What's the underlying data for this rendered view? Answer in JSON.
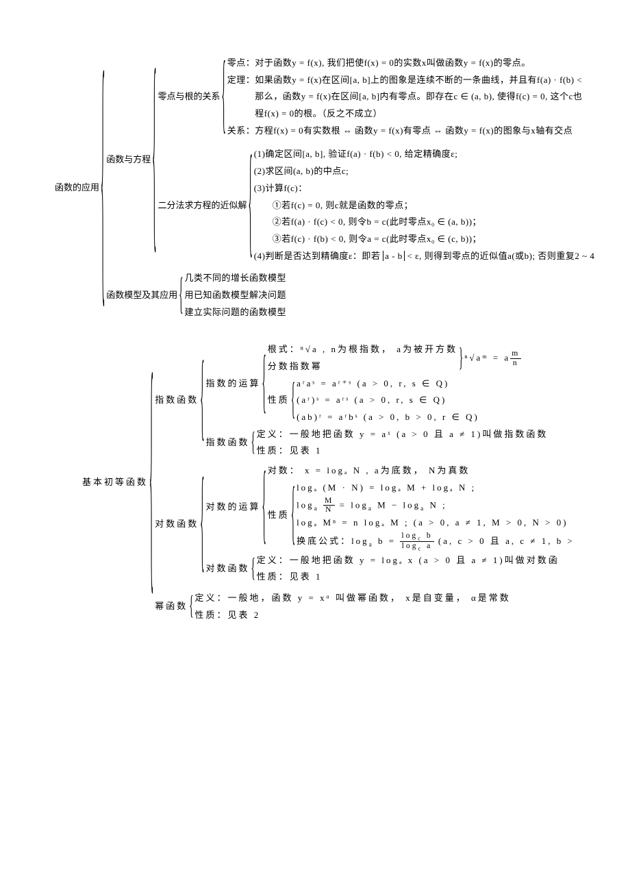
{
  "section1": {
    "root": "函数的应用",
    "b1": {
      "label": "函数与方程",
      "c1": {
        "label": "零点与根的关系",
        "lines": [
          "零点：对于函数y = f(x), 我们把使f(x) = 0的实数x叫做函数y = f(x)的零点。",
          "定理：如果函数y = f(x)在区间[a, b]上的图象是连续不断的一条曲线，并且有f(a) · f(b) < ",
          "　　　那么，函数y = f(x)在区间[a, b]内有零点。即存在c ∈ (a, b), 使得f(c) = 0, 这个c也",
          "　　　程f(x) = 0的根。（反之不成立）",
          "关系：方程f(x) = 0有实数根 ⇔ 函数y = f(x)有零点 ⇔ 函数y = f(x)的图象与x轴有交点"
        ]
      },
      "c2": {
        "label": "二分法求方程的近似解",
        "lines": [
          "(1)确定区间[a, b], 验证f(a) · f(b) < 0, 给定精确度ε;",
          "(2)求区间(a, b)的中点c;",
          "(3)计算f(c)：",
          "　　①若f(c) = 0, 则c就是函数的零点；",
          "　　②若f(a) · f(c) < 0, 则令b = c(此时零点x₀ ∈ (a, b))；",
          "　　③若f(c) · f(b) < 0, 则令a = c(此时零点x₀ ∈ (c, b))；",
          "(4)判断是否达到精确度ε：即若|a - b| < ε, 则得到零点的近似值a(或b); 否则重复2 ~ 4"
        ]
      }
    },
    "b2": {
      "label": "函数模型及其应用",
      "lines": [
        "几类不同的增长函数模型",
        "用已知函数模型解决问题",
        "建立实际问题的函数模型"
      ]
    }
  },
  "section2": {
    "root": "基本初等函数",
    "exp": {
      "label": "指数函数",
      "yunsuan": {
        "label": "指数的运算",
        "radical": "根式：ⁿ√a , n为根指数， a为被开方数",
        "fenzhishu": "分数指数幂",
        "radical_eq": "ⁿ√aᵐ = a",
        "radical_eq_frac_n": "m",
        "radical_eq_frac_d": "n",
        "xingzhi_label": "性质",
        "rules": [
          "aʳaˢ = aʳ⁺ˢ (a > 0, r, s ∈ Q)",
          "(aʳ)ˢ = aʳˢ (a > 0, r, s ∈ Q)",
          "(ab)ʳ = aʳbˢ (a > 0, b > 0, r ∈ Q)"
        ]
      },
      "hanshu": {
        "label": "指数函数",
        "def": "定义：一般地把函数 y = aˣ (a > 0 且 a ≠ 1)叫做指数函数",
        "prop": "性质：见表 1"
      }
    },
    "log": {
      "label": "对数函数",
      "yunsuan": {
        "label": "对数的运算",
        "duishu": "对数： x = logₐ N , a为底数， N为真数",
        "xingzhi_label": "性质",
        "rules": [
          "logₐ (M · N) = logₐ M + logₐ N ;",
          "logₐ M/N = logₐ M − logₐ N ;",
          "logₐ Mⁿ = n logₐ M ; (a > 0, a ≠ 1, M > 0, N > 0)",
          "换底公式：logₐ b = log_c b / log_c a (a, c > 0 且 a, c ≠ 1, b >"
        ]
      },
      "hanshu": {
        "label": "对数函数",
        "def": "定义：一般地把函数 y = logₐ x (a > 0 且 a ≠ 1)叫做对数函",
        "prop": "性质：见表 1"
      }
    },
    "power": {
      "label": "幂函数",
      "def": "定义：一般地，函数 y = xᵅ 叫做幂函数， x是自变量， α是常数",
      "prop": "性质：见表 2"
    }
  }
}
